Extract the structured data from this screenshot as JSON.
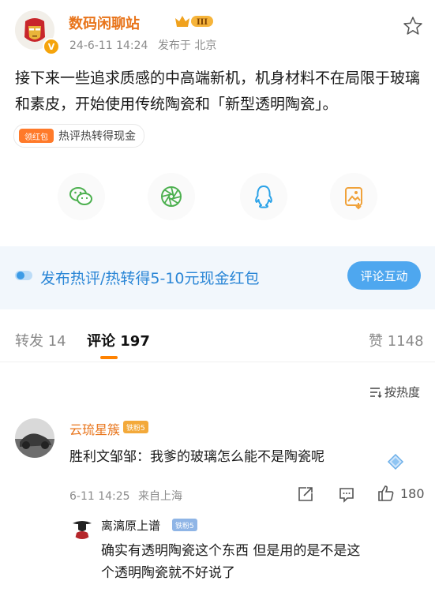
{
  "post": {
    "author": "数码闲聊站",
    "level": "III",
    "verified_mark": "V",
    "date": "24-6-11 14:24",
    "location": "发布于 北京",
    "content": "接下来一些追求质感的中高端新机，机身材料不在局限于玻璃和素皮，开始使用传统陶瓷和「新型透明陶瓷」。",
    "tag_icon_label": "领红包",
    "tag_text": "热评热转得现金"
  },
  "share": [
    {
      "name": "wechat",
      "color": "#4cb04f"
    },
    {
      "name": "moments",
      "color": "#4cb04f"
    },
    {
      "name": "qq",
      "color": "#2aa2e8"
    },
    {
      "name": "save-image",
      "color": "#f0a23a"
    }
  ],
  "banner": {
    "text": "发布热评/热转得5-10元现金红包",
    "button": "评论互动",
    "accent": "#2a86d6"
  },
  "tabs": {
    "repost_label": "转发 14",
    "comment_label": "评论 197",
    "like_label": "赞 1148"
  },
  "sort_label": "按热度",
  "comments": [
    {
      "user": "云琉星簇",
      "badge": "铁粉5",
      "text": "胜利文邹邹：我爹的玻璃怎么能不是陶瓷呢",
      "time": "6-11 14:25",
      "location": "来自上海",
      "likes": "180"
    }
  ],
  "reply": {
    "user": "离漓原上谱",
    "badge": "铁粉5",
    "text_line1": "确实有透明陶瓷这个东西 但是用的是不是这",
    "text_line2": "个透明陶瓷就不好说了"
  }
}
